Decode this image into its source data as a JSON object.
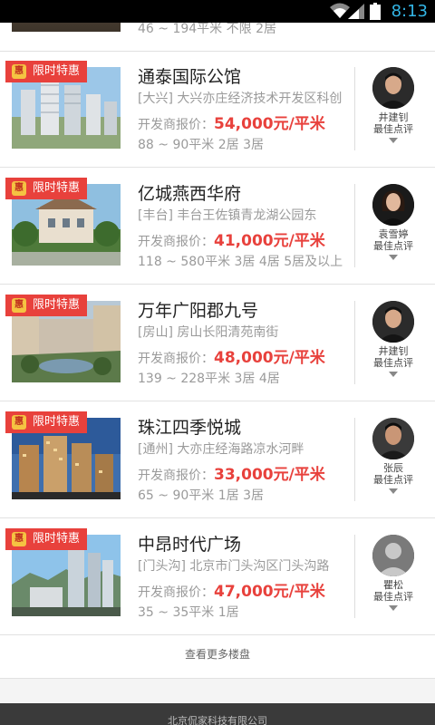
{
  "status_bar": {
    "time": "8:13"
  },
  "partial_item": {
    "meta": "46 ~ 194平米  不限 2居"
  },
  "listings": [
    {
      "promo": "限时特惠",
      "title": "通泰国际公馆",
      "district": "[大兴]",
      "address": "大兴亦庄经济技术开发区科创",
      "price_label": "开发商报价：",
      "price": "54,000元/平米",
      "area": "88 ~ 90平米  2居 3居",
      "agent_name": "井建钊",
      "agent_label": "最佳点评"
    },
    {
      "promo": "限时特惠",
      "title": "亿城燕西华府",
      "district": "[丰台]",
      "address": "丰台王佐镇青龙湖公园东",
      "price_label": "开发商报价：",
      "price": "41,000元/平米",
      "area": "118 ~ 580平米  3居 4居 5居及以上",
      "agent_name": "袁雪婷",
      "agent_label": "最佳点评"
    },
    {
      "promo": "限时特惠",
      "title": "万年广阳郡九号",
      "district": "[房山]",
      "address": "房山长阳清苑南街",
      "price_label": "开发商报价：",
      "price": "48,000元/平米",
      "area": "139 ~ 228平米  3居 4居",
      "agent_name": "井建钊",
      "agent_label": "最佳点评"
    },
    {
      "promo": "限时特惠",
      "title": "珠江四季悦城",
      "district": "[通州]",
      "address": "大亦庄经海路凉水河畔",
      "price_label": "开发商报价：",
      "price": "33,000元/平米",
      "area": "65 ~ 90平米  1居 3居",
      "agent_name": "张辰",
      "agent_label": "最佳点评"
    },
    {
      "promo": "限时特惠",
      "title": "中昂时代广场",
      "district": "[门头沟]",
      "address": "北京市门头沟区门头沟路",
      "price_label": "开发商报价：",
      "price": "47,000元/平米",
      "area": "35 ~ 35平米  1居",
      "agent_name": "瞿松",
      "agent_label": "最佳点评"
    }
  ],
  "more_link": "查看更多楼盘",
  "footer": "北京侃家科技有限公司",
  "colors": {
    "accent": "#e8413c",
    "status_time": "#33b5e5"
  }
}
